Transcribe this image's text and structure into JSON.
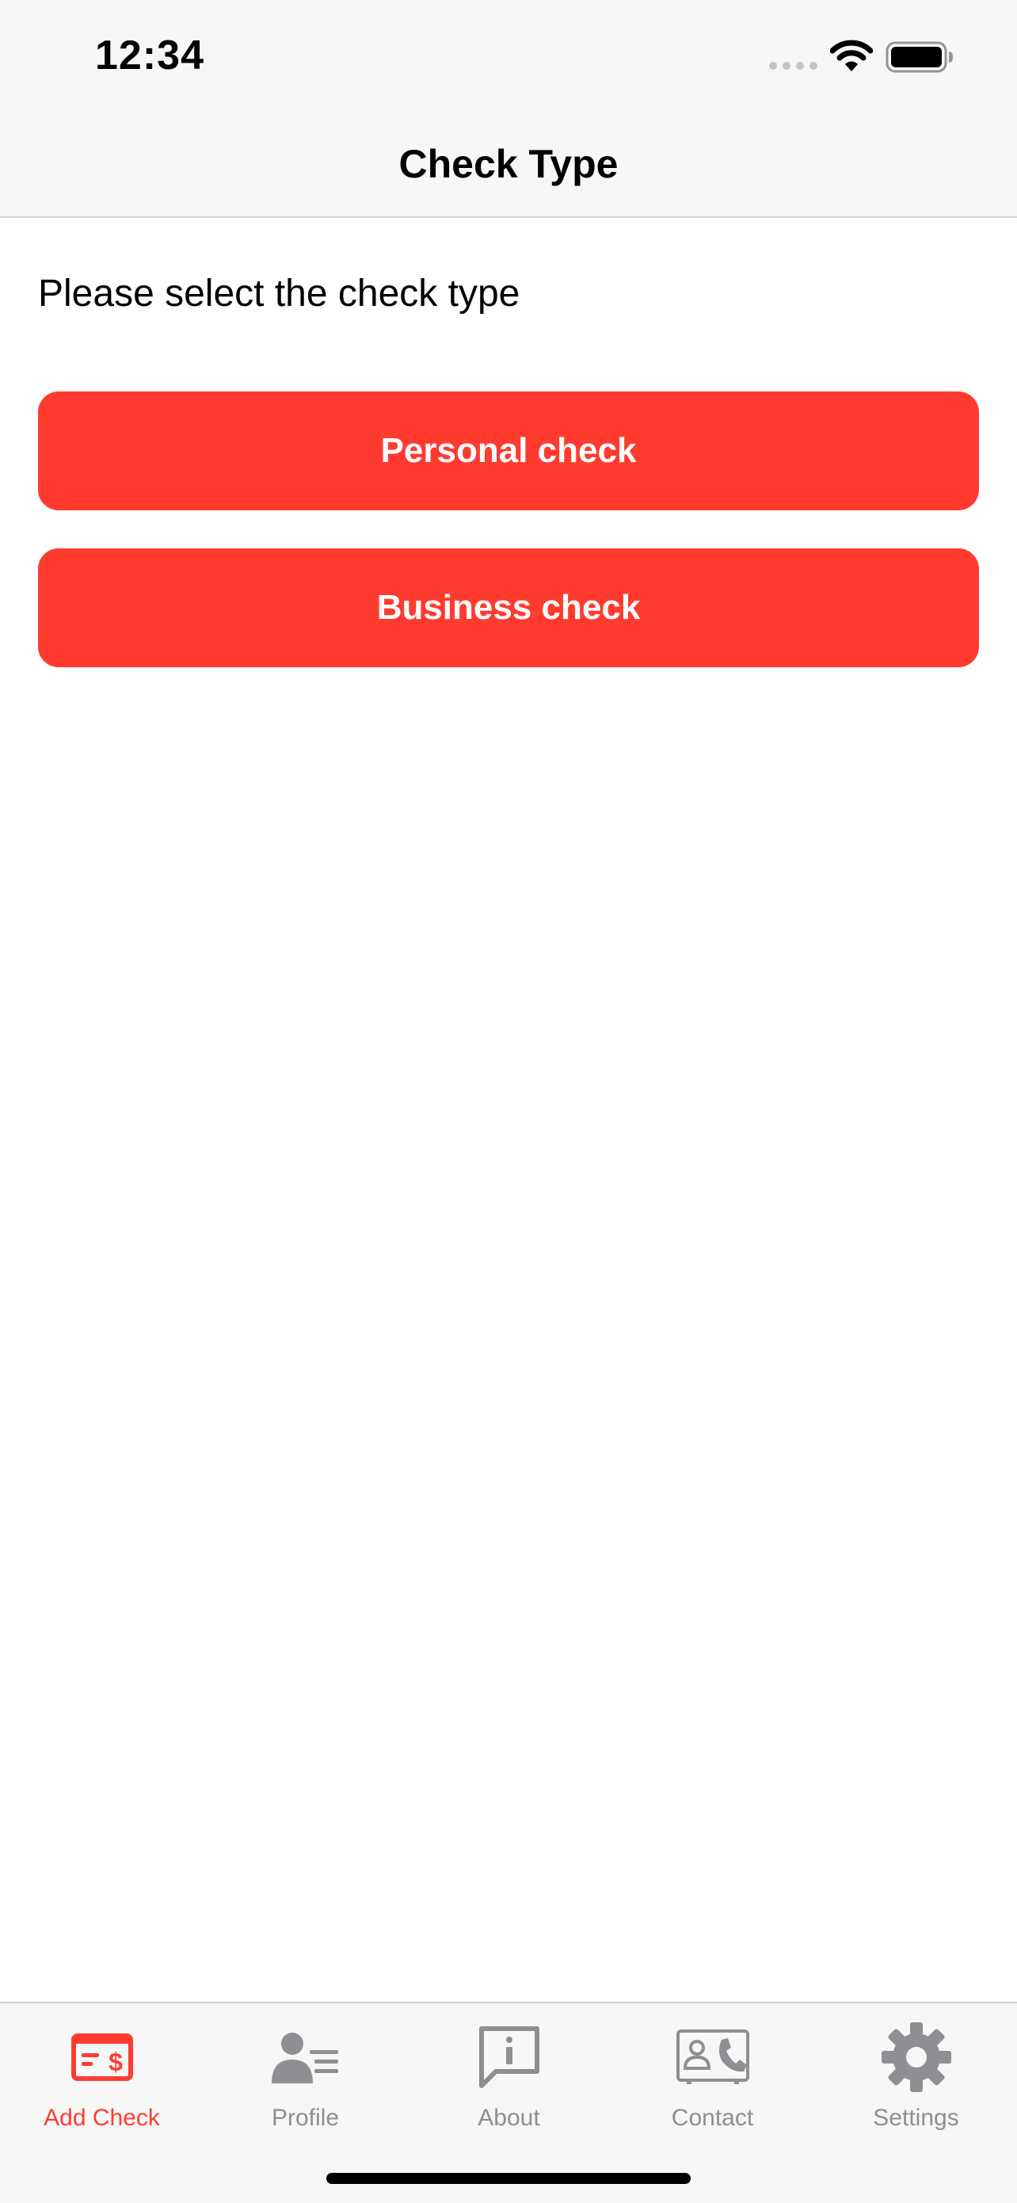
{
  "status_bar": {
    "time": "12:34"
  },
  "nav": {
    "title": "Check Type"
  },
  "content": {
    "prompt": "Please select the check type",
    "buttons": [
      {
        "label": "Personal check"
      },
      {
        "label": "Business check"
      }
    ]
  },
  "tab_bar": {
    "items": [
      {
        "label": "Add Check",
        "icon": "check-dollar-icon",
        "active": true
      },
      {
        "label": "Profile",
        "icon": "profile-card-icon",
        "active": false
      },
      {
        "label": "About",
        "icon": "info-bubble-icon",
        "active": false
      },
      {
        "label": "Contact",
        "icon": "contact-card-icon",
        "active": false
      },
      {
        "label": "Settings",
        "icon": "gear-icon",
        "active": false
      }
    ]
  },
  "colors": {
    "accent": "#ff3b30",
    "inactive": "#8e8e93",
    "bar_background": "#f7f7f7"
  }
}
